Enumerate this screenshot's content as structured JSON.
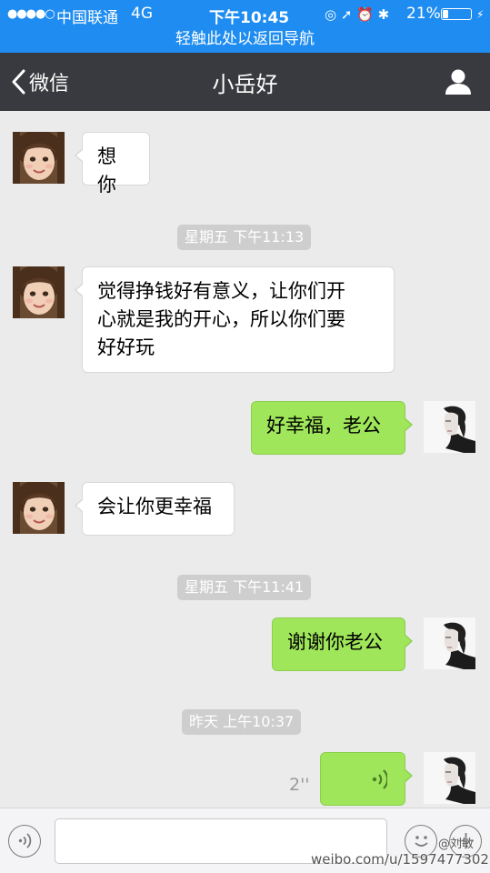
{
  "status_bar": {
    "signal_dots": "●●●●○",
    "carrier": "中国联通",
    "network": "4G",
    "time": "下午10:45",
    "status_icons": "◎ ➚ ⏰ ✱",
    "battery_percent": "21%",
    "battery_level": 0.21,
    "charging_icon": "⚡"
  },
  "return_banner": {
    "text": "轻触此处以返回导航"
  },
  "nav": {
    "back_icon": "chevron-left-icon",
    "back_label": "微信",
    "title": "小岳好",
    "profile_icon": "person-icon"
  },
  "messages": [
    {
      "type": "text",
      "direction": "incoming",
      "text": "想你"
    },
    {
      "type": "timestamp",
      "text": "星期五 下午11:13"
    },
    {
      "type": "text",
      "direction": "incoming",
      "lines": [
        "觉得挣钱好有意义，让你们开",
        "心就是我的开心，所以你们要",
        "好好玩"
      ]
    },
    {
      "type": "text",
      "direction": "outgoing",
      "text": "好幸福，老公"
    },
    {
      "type": "text",
      "direction": "incoming",
      "text": "会让你更幸福"
    },
    {
      "type": "timestamp",
      "text": "星期五 下午11:41"
    },
    {
      "type": "text",
      "direction": "outgoing",
      "text": "谢谢你老公"
    },
    {
      "type": "timestamp",
      "text": "昨天 上午10:37"
    },
    {
      "type": "voice",
      "direction": "outgoing",
      "duration": "2''",
      "icon": "voice-wave-icon"
    }
  ],
  "input_bar": {
    "voice_toggle_icon": "voice-wave-icon",
    "emoji_icon": "emoji-icon",
    "add_icon": "plus-icon"
  },
  "watermark": {
    "url": "weibo.com/u/1597477302",
    "user": "@刘敏"
  },
  "colors": {
    "status_bar": "#1e8cf0",
    "nav_bar": "#393a3f",
    "chat_background": "#ebebeb",
    "outgoing_bubble": "#9fe65a",
    "incoming_bubble": "#ffffff",
    "timestamp_pill": "#cecece"
  }
}
